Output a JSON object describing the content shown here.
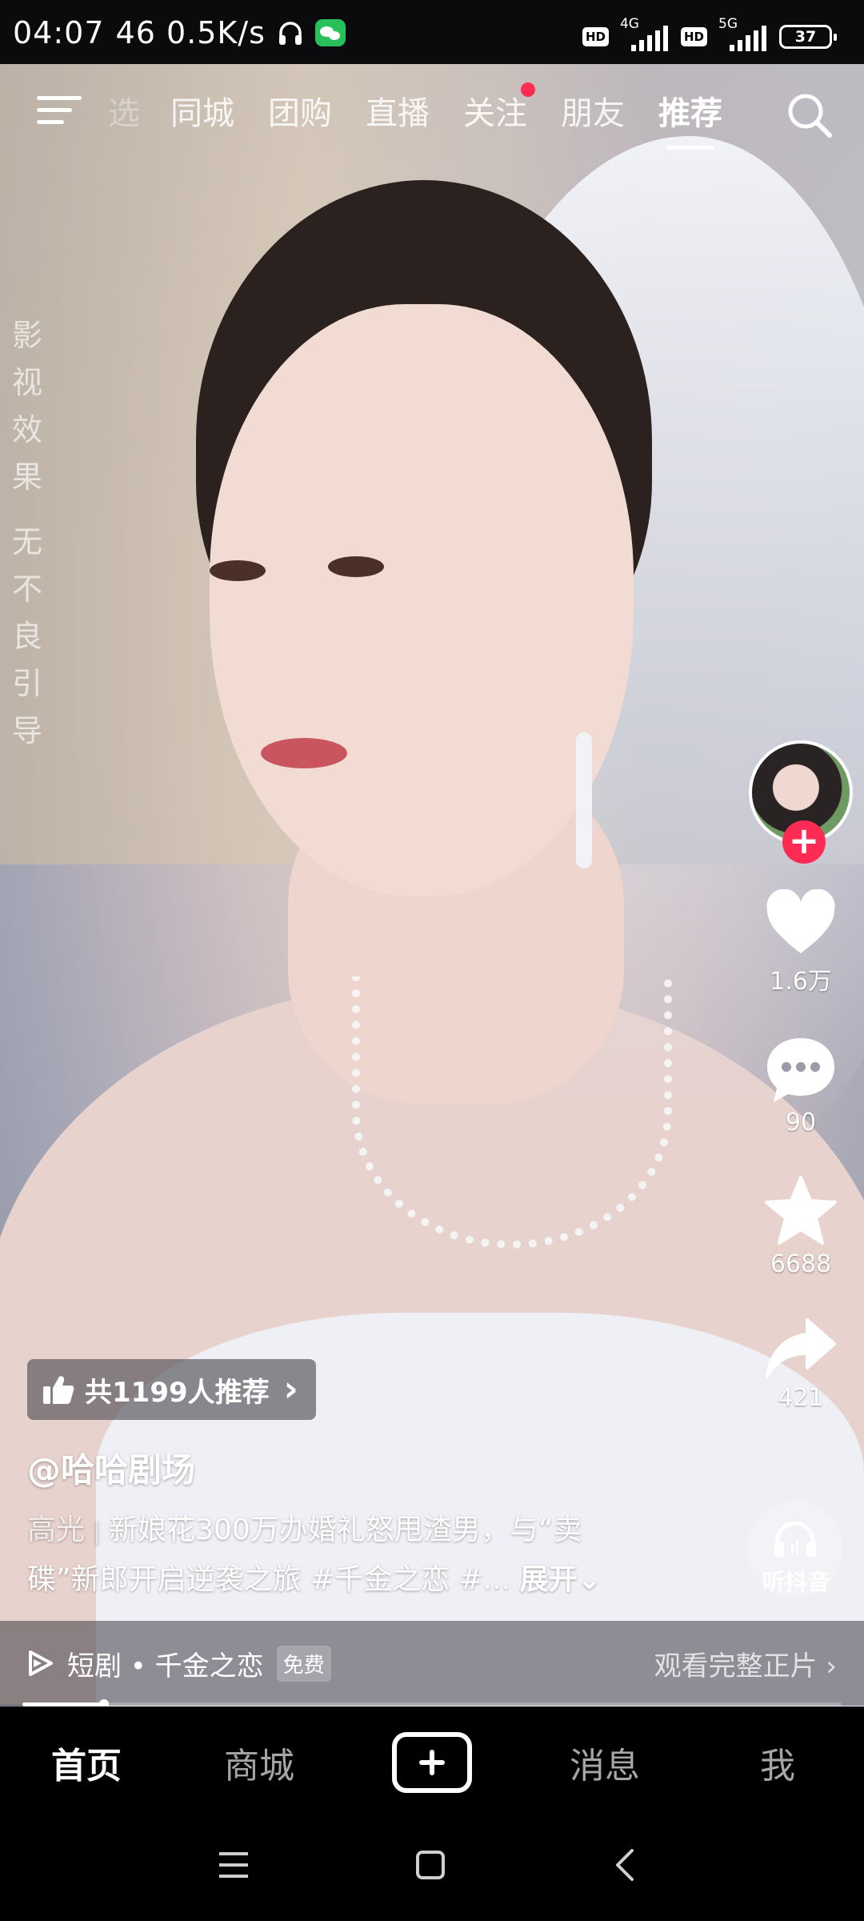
{
  "status_bar": {
    "time": "04:07",
    "net_speed": "46 0.5K/s",
    "hd1": "HD",
    "net1": "4G",
    "hd2": "HD",
    "net2": "5G",
    "battery": "37"
  },
  "top_tabs": {
    "partial_tab": "选",
    "tabs": [
      "同城",
      "团购",
      "直播",
      "关注",
      "朋友",
      "推荐"
    ],
    "active_tab": "推荐"
  },
  "side_notice": [
    "影",
    "视",
    "效",
    "果",
    "无",
    "不",
    "良",
    "引",
    "导"
  ],
  "actions": {
    "like_count": "1.6万",
    "comment_count": "90",
    "favorite_count": "6688",
    "share_count": "421",
    "listen_label": "听抖音",
    "follow_glyph": "+"
  },
  "recommend": {
    "text": "共1199人推荐",
    "chevron": "›"
  },
  "video_info": {
    "author": "@哈哈剧场",
    "highlight_tag": "高光",
    "separator": "|",
    "line1": "新娘花300万办婚礼怒甩渣男，与“卖",
    "line2": "碟”新郎开启逆袭之旅 #千金之恋 #...",
    "expand": "展开⌄"
  },
  "drama_bar": {
    "title": "短剧 • 千金之恋",
    "badge": "免费",
    "watch": "观看完整正片 ›"
  },
  "progress": {
    "fraction": 0.1
  },
  "bottom_nav": {
    "home": "首页",
    "mall": "商城",
    "messages": "消息",
    "me": "我"
  },
  "colors": {
    "accent": "#fe2c55",
    "nav_background": "#000000"
  }
}
